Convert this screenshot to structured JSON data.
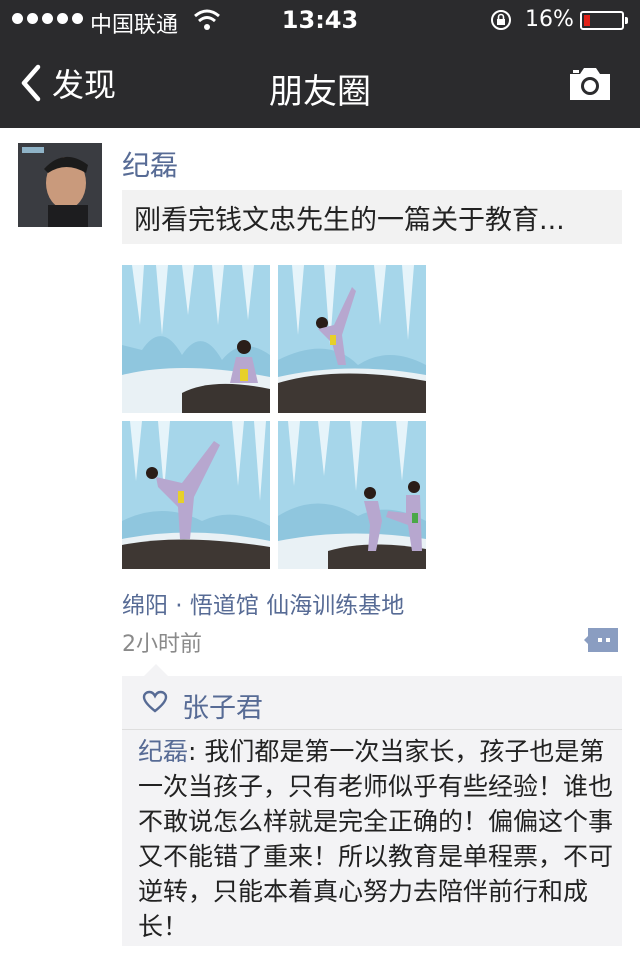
{
  "status_bar": {
    "carrier": "中国联通",
    "time": "13:43",
    "battery_pct": "16%",
    "battery_level": 0.16,
    "battery_color": "#e2231a"
  },
  "nav": {
    "back_label": "发现",
    "title": "朋友圈"
  },
  "post": {
    "author": "纪磊",
    "share_text": "刚看完钱文忠先生的一篇关于教育...",
    "location": "绵阳 · 悟道馆  仙海训练基地",
    "time": "2小时前",
    "likes": [
      "张子君"
    ],
    "comments": [
      {
        "author": "纪磊",
        "separator": ": ",
        "text": "我们都是第一次当家长，孩子也是第一次当孩子，只有老师似乎有些经验！谁也不敢说怎么样就是完全正确的！偏偏这个事又不能错了重来！所以教育是单程票，不可逆转，只能本着真心努力去陪伴前行和成长！"
      }
    ]
  },
  "colors": {
    "bar_bg": "#2b2b2d",
    "link": "#576b95",
    "comment_bg": "#f3f3f5"
  }
}
